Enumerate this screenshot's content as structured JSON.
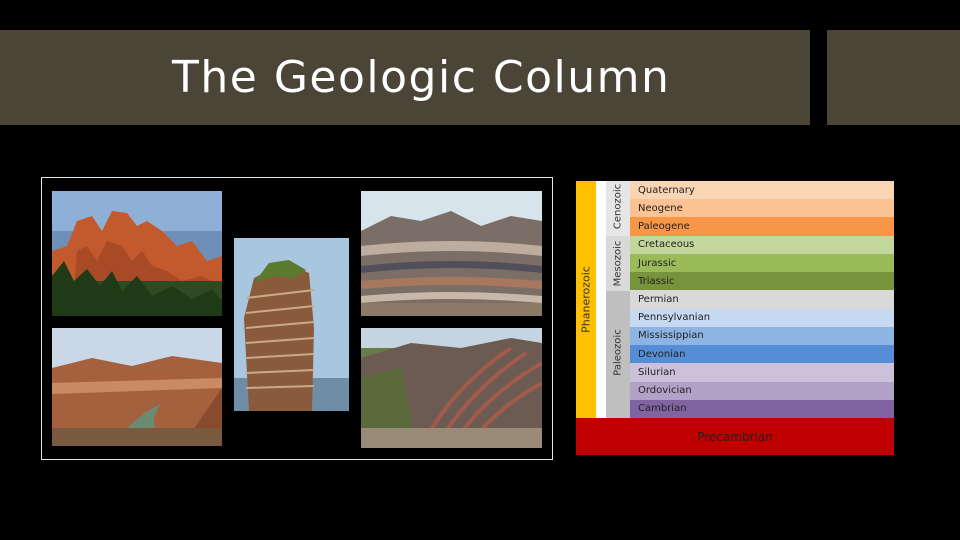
{
  "slide": {
    "title": "The Geologic Column"
  },
  "collage": {
    "photos": [
      {
        "name": "red-hoodoo-cliffs-photo"
      },
      {
        "name": "banded-sea-stack-photo"
      },
      {
        "name": "striped-badlands-photo"
      },
      {
        "name": "canyon-river-photo"
      },
      {
        "name": "folded-rock-strata-photo"
      }
    ]
  },
  "geologic_column": {
    "eon": "Phanerozoic",
    "eras": [
      "Cenozoic",
      "Mesozoic",
      "Paleozoic"
    ],
    "periods": [
      {
        "label": "Quaternary",
        "color": "#fad5b4"
      },
      {
        "label": "Neogene",
        "color": "#fbc293"
      },
      {
        "label": "Paleogene",
        "color": "#f79646"
      },
      {
        "label": "Cretaceous",
        "color": "#c3d69b"
      },
      {
        "label": "Jurassic",
        "color": "#9bbb59"
      },
      {
        "label": "Triassic",
        "color": "#77933c"
      },
      {
        "label": "Permian",
        "color": "#d9d9d9"
      },
      {
        "label": "Pennsylvanian",
        "color": "#c6d9f1"
      },
      {
        "label": "Mississippian",
        "color": "#8eb4e3"
      },
      {
        "label": "Devonian",
        "color": "#558ed5"
      },
      {
        "label": "Silurian",
        "color": "#ccc1da"
      },
      {
        "label": "Ordovician",
        "color": "#b3a2c7"
      },
      {
        "label": "Cambrian",
        "color": "#8064a2"
      }
    ],
    "precambrian": "Precambrian",
    "colors": {
      "eon_band": "#ffc000",
      "era_band": "#bfbfbf",
      "precambrian": "#c00000"
    }
  }
}
